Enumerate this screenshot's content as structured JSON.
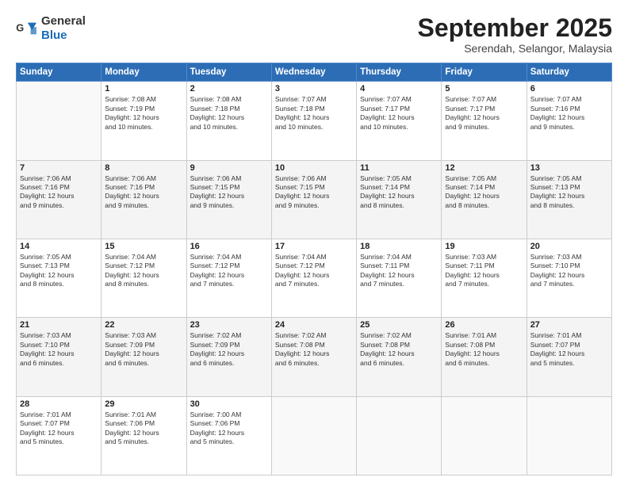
{
  "logo": {
    "general": "General",
    "blue": "Blue"
  },
  "header": {
    "month": "September 2025",
    "location": "Serendah, Selangor, Malaysia"
  },
  "weekdays": [
    "Sunday",
    "Monday",
    "Tuesday",
    "Wednesday",
    "Thursday",
    "Friday",
    "Saturday"
  ],
  "weeks": [
    [
      {
        "day": "",
        "info": ""
      },
      {
        "day": "1",
        "info": "Sunrise: 7:08 AM\nSunset: 7:19 PM\nDaylight: 12 hours\nand 10 minutes."
      },
      {
        "day": "2",
        "info": "Sunrise: 7:08 AM\nSunset: 7:18 PM\nDaylight: 12 hours\nand 10 minutes."
      },
      {
        "day": "3",
        "info": "Sunrise: 7:07 AM\nSunset: 7:18 PM\nDaylight: 12 hours\nand 10 minutes."
      },
      {
        "day": "4",
        "info": "Sunrise: 7:07 AM\nSunset: 7:17 PM\nDaylight: 12 hours\nand 10 minutes."
      },
      {
        "day": "5",
        "info": "Sunrise: 7:07 AM\nSunset: 7:17 PM\nDaylight: 12 hours\nand 9 minutes."
      },
      {
        "day": "6",
        "info": "Sunrise: 7:07 AM\nSunset: 7:16 PM\nDaylight: 12 hours\nand 9 minutes."
      }
    ],
    [
      {
        "day": "7",
        "info": "Sunrise: 7:06 AM\nSunset: 7:16 PM\nDaylight: 12 hours\nand 9 minutes."
      },
      {
        "day": "8",
        "info": "Sunrise: 7:06 AM\nSunset: 7:16 PM\nDaylight: 12 hours\nand 9 minutes."
      },
      {
        "day": "9",
        "info": "Sunrise: 7:06 AM\nSunset: 7:15 PM\nDaylight: 12 hours\nand 9 minutes."
      },
      {
        "day": "10",
        "info": "Sunrise: 7:06 AM\nSunset: 7:15 PM\nDaylight: 12 hours\nand 9 minutes."
      },
      {
        "day": "11",
        "info": "Sunrise: 7:05 AM\nSunset: 7:14 PM\nDaylight: 12 hours\nand 8 minutes."
      },
      {
        "day": "12",
        "info": "Sunrise: 7:05 AM\nSunset: 7:14 PM\nDaylight: 12 hours\nand 8 minutes."
      },
      {
        "day": "13",
        "info": "Sunrise: 7:05 AM\nSunset: 7:13 PM\nDaylight: 12 hours\nand 8 minutes."
      }
    ],
    [
      {
        "day": "14",
        "info": "Sunrise: 7:05 AM\nSunset: 7:13 PM\nDaylight: 12 hours\nand 8 minutes."
      },
      {
        "day": "15",
        "info": "Sunrise: 7:04 AM\nSunset: 7:12 PM\nDaylight: 12 hours\nand 8 minutes."
      },
      {
        "day": "16",
        "info": "Sunrise: 7:04 AM\nSunset: 7:12 PM\nDaylight: 12 hours\nand 7 minutes."
      },
      {
        "day": "17",
        "info": "Sunrise: 7:04 AM\nSunset: 7:12 PM\nDaylight: 12 hours\nand 7 minutes."
      },
      {
        "day": "18",
        "info": "Sunrise: 7:04 AM\nSunset: 7:11 PM\nDaylight: 12 hours\nand 7 minutes."
      },
      {
        "day": "19",
        "info": "Sunrise: 7:03 AM\nSunset: 7:11 PM\nDaylight: 12 hours\nand 7 minutes."
      },
      {
        "day": "20",
        "info": "Sunrise: 7:03 AM\nSunset: 7:10 PM\nDaylight: 12 hours\nand 7 minutes."
      }
    ],
    [
      {
        "day": "21",
        "info": "Sunrise: 7:03 AM\nSunset: 7:10 PM\nDaylight: 12 hours\nand 6 minutes."
      },
      {
        "day": "22",
        "info": "Sunrise: 7:03 AM\nSunset: 7:09 PM\nDaylight: 12 hours\nand 6 minutes."
      },
      {
        "day": "23",
        "info": "Sunrise: 7:02 AM\nSunset: 7:09 PM\nDaylight: 12 hours\nand 6 minutes."
      },
      {
        "day": "24",
        "info": "Sunrise: 7:02 AM\nSunset: 7:08 PM\nDaylight: 12 hours\nand 6 minutes."
      },
      {
        "day": "25",
        "info": "Sunrise: 7:02 AM\nSunset: 7:08 PM\nDaylight: 12 hours\nand 6 minutes."
      },
      {
        "day": "26",
        "info": "Sunrise: 7:01 AM\nSunset: 7:08 PM\nDaylight: 12 hours\nand 6 minutes."
      },
      {
        "day": "27",
        "info": "Sunrise: 7:01 AM\nSunset: 7:07 PM\nDaylight: 12 hours\nand 5 minutes."
      }
    ],
    [
      {
        "day": "28",
        "info": "Sunrise: 7:01 AM\nSunset: 7:07 PM\nDaylight: 12 hours\nand 5 minutes."
      },
      {
        "day": "29",
        "info": "Sunrise: 7:01 AM\nSunset: 7:06 PM\nDaylight: 12 hours\nand 5 minutes."
      },
      {
        "day": "30",
        "info": "Sunrise: 7:00 AM\nSunset: 7:06 PM\nDaylight: 12 hours\nand 5 minutes."
      },
      {
        "day": "",
        "info": ""
      },
      {
        "day": "",
        "info": ""
      },
      {
        "day": "",
        "info": ""
      },
      {
        "day": "",
        "info": ""
      }
    ]
  ]
}
